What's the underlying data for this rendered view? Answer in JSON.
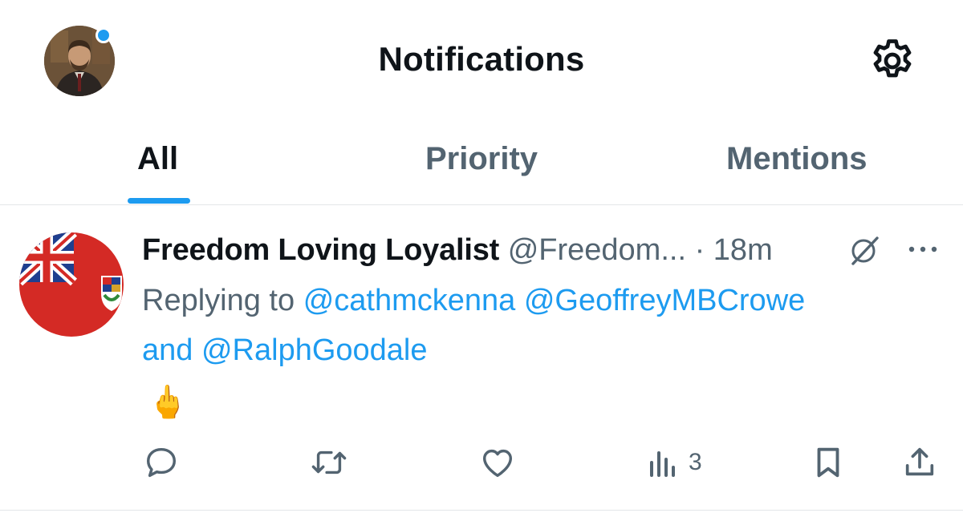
{
  "header": {
    "title": "Notifications",
    "avatar_icon": "user-avatar",
    "settings_icon": "gear-icon",
    "unread_color": "#1d9bf0"
  },
  "tabs": [
    {
      "label": "All",
      "active": true
    },
    {
      "label": "Priority",
      "active": false
    },
    {
      "label": "Mentions",
      "active": false
    }
  ],
  "tweet": {
    "author_name": "Freedom Loving Loyalist",
    "author_handle": "@Freedom...",
    "separator": "·",
    "time": "18m",
    "replying_to_prefix": "Replying to",
    "mentions": [
      "@cathmckenna",
      "@GeoffreyMBCrowe",
      "@RalphGoodale"
    ],
    "conjunction": "and",
    "content": "🖕",
    "actions": {
      "reply_icon": "reply-icon",
      "retweet_icon": "retweet-icon",
      "like_icon": "heart-icon",
      "views_icon": "views-icon",
      "views_count": "3",
      "bookmark_icon": "bookmark-icon",
      "share_icon": "share-icon"
    }
  },
  "colors": {
    "accent": "#1d9bf0",
    "text_primary": "#0f1419",
    "text_secondary": "#536471",
    "divider": "#e3e6e8"
  }
}
